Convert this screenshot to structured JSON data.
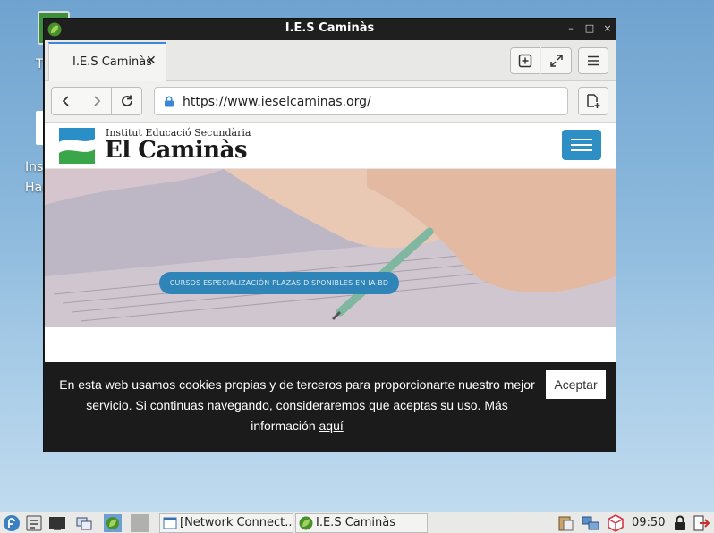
{
  "desktop": {
    "icons": [
      {
        "label": "T"
      },
      {
        "label_line1": "Ins",
        "label_line2": "Har"
      }
    ]
  },
  "window": {
    "title": "I.E.S Caminàs",
    "min_glyph": "–",
    "max_glyph": "□",
    "close_glyph": "×"
  },
  "browser": {
    "tab_label": "I.E.S Caminàs",
    "tab_close": "✕",
    "url": "https://www.ieselcaminas.org/",
    "icons": {
      "new_tab": "new-tab-icon",
      "fullscreen": "fullscreen-icon",
      "menu": "menu-icon",
      "back": "back-icon",
      "forward": "forward-icon",
      "reload": "reload-icon",
      "bookmark": "add-bookmark-icon"
    }
  },
  "site": {
    "logo_subtitle": "Institut Educació Secundària",
    "logo_title": "El Caminàs",
    "hero_button": "CURSOS ESPECIALIZACIÓN PLAZAS DISPONIBLES EN IA-BD",
    "accent_color": "#2d8fc4"
  },
  "cookie_banner": {
    "text": "En esta web usamos cookies propias y de terceros para proporcionarte nuestro mejor servicio. Si continuas navegando, consideraremos que aceptas su uso. Más información ",
    "link": "aquí",
    "accept": "Aceptar"
  },
  "taskbar": {
    "tasks": [
      {
        "label": "[Network Connect..."
      },
      {
        "label": "I.E.S Caminàs"
      }
    ],
    "clock": "09:50"
  }
}
